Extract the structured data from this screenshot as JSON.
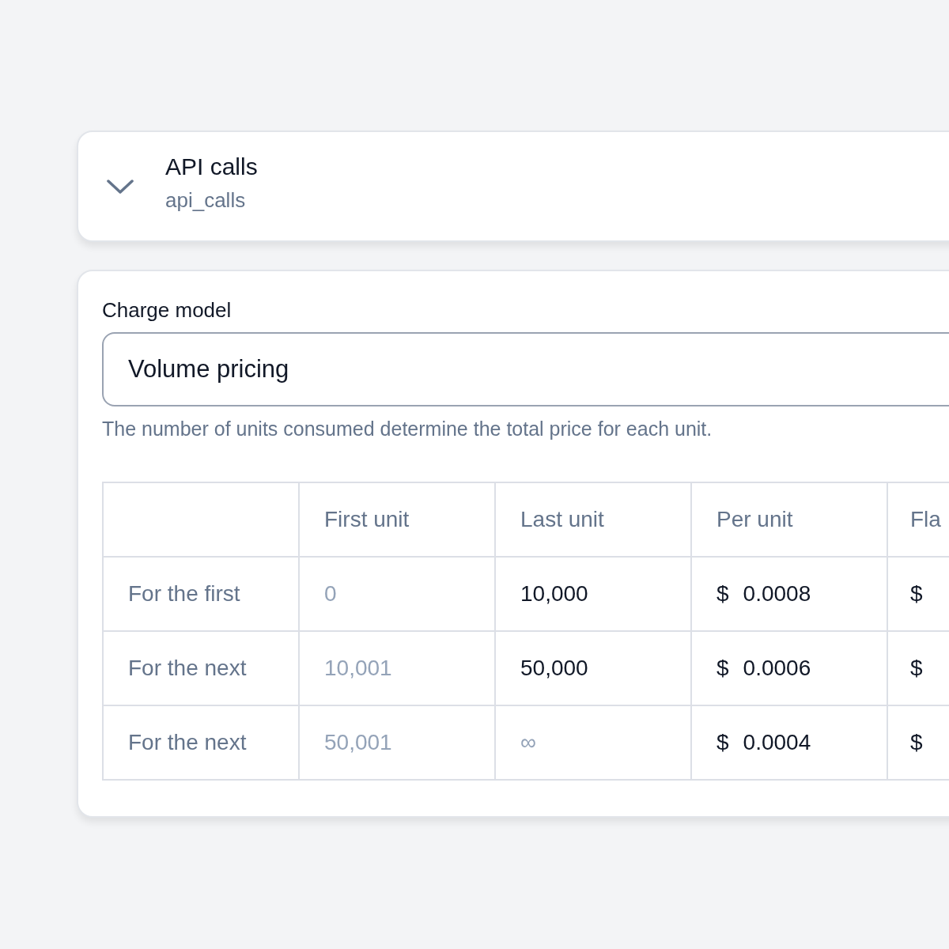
{
  "metric": {
    "title": "API calls",
    "key": "api_calls",
    "expanded": true
  },
  "charge_model": {
    "label": "Charge model",
    "value": "Volume pricing",
    "help": "The number of units consumed determine the total price for each unit."
  },
  "tiers": {
    "columns": [
      "First unit",
      "Last unit",
      "Per unit",
      "Fla"
    ],
    "rows": [
      {
        "label": "For the first",
        "first_unit": "0",
        "last_unit": {
          "value": "10,000"
        },
        "per_unit": {
          "currency": "$",
          "value": "0.0008"
        },
        "flat_fee": {
          "currency": "$"
        }
      },
      {
        "label": "For the next",
        "first_unit": "10,001",
        "last_unit": {
          "value": "50,000"
        },
        "per_unit": {
          "currency": "$",
          "value": "0.0006"
        },
        "flat_fee": {
          "currency": "$"
        }
      },
      {
        "label": "For the next",
        "first_unit": "50,001",
        "last_unit": {
          "placeholder": "∞"
        },
        "per_unit": {
          "currency": "$",
          "value": "0.0004"
        },
        "flat_fee": {
          "currency": "$"
        }
      }
    ]
  }
}
